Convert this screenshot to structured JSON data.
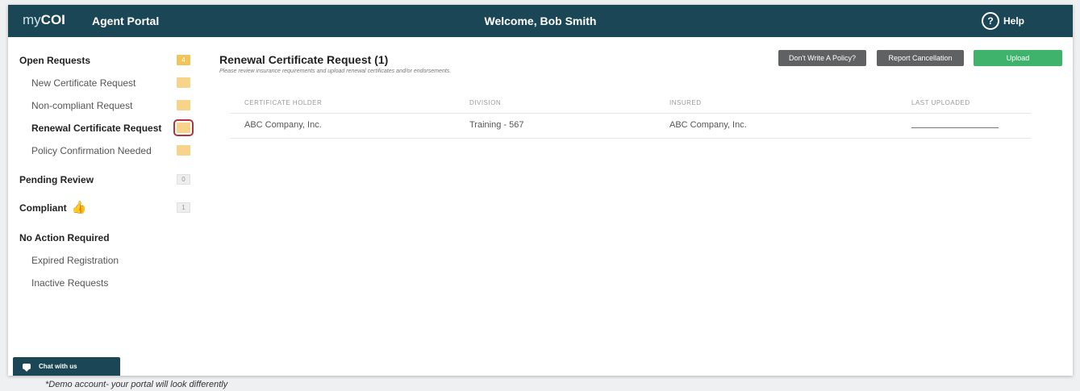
{
  "header": {
    "logo_my": "my",
    "logo_coi": "COI",
    "portal_name": "Agent Portal",
    "welcome": "Welcome, Bob Smith",
    "help_icon": "?",
    "help_label": "Help"
  },
  "sidebar": {
    "open_requests": {
      "label": "Open Requests",
      "count": "4"
    },
    "new_certificate": {
      "label": "New Certificate Request",
      "count": ""
    },
    "non_compliant": {
      "label": "Non-compliant Request",
      "count": ""
    },
    "renewal": {
      "label": "Renewal Certificate Request",
      "count": ""
    },
    "policy_confirmation": {
      "label": "Policy Confirmation Needed",
      "count": ""
    },
    "pending_review": {
      "label": "Pending Review",
      "count": "0"
    },
    "compliant": {
      "label": "Compliant",
      "count": "1",
      "icon": "thumbs-up-icon"
    },
    "no_action": {
      "label": "No Action Required"
    },
    "expired_registration": {
      "label": "Expired Registration"
    },
    "inactive_requests": {
      "label": "Inactive Requests"
    }
  },
  "main": {
    "title": "Renewal Certificate Request (1)",
    "subtitle": "Please review insurance requirements and upload renewal certificates and/or endorsements.",
    "buttons": {
      "dont_write": "Don't Write A Policy?",
      "report_cancellation": "Report Cancellation",
      "upload": "Upload"
    },
    "table": {
      "headers": [
        "CERTIFICATE HOLDER",
        "DIVISION",
        "INSURED",
        "LAST UPLOADED"
      ],
      "rows": [
        [
          "ABC Company, Inc.",
          "Training - 567",
          "ABC Company, Inc.",
          ""
        ]
      ]
    }
  },
  "chat": {
    "label": "Chat with us"
  },
  "footnote": "*Demo account- your portal will look differently",
  "colors": {
    "header_bg": "#1b4655",
    "badge": "#f3c45a",
    "upload_green": "#3fb36b",
    "dark_button": "#5f6163",
    "active_outline": "#b0343f"
  }
}
